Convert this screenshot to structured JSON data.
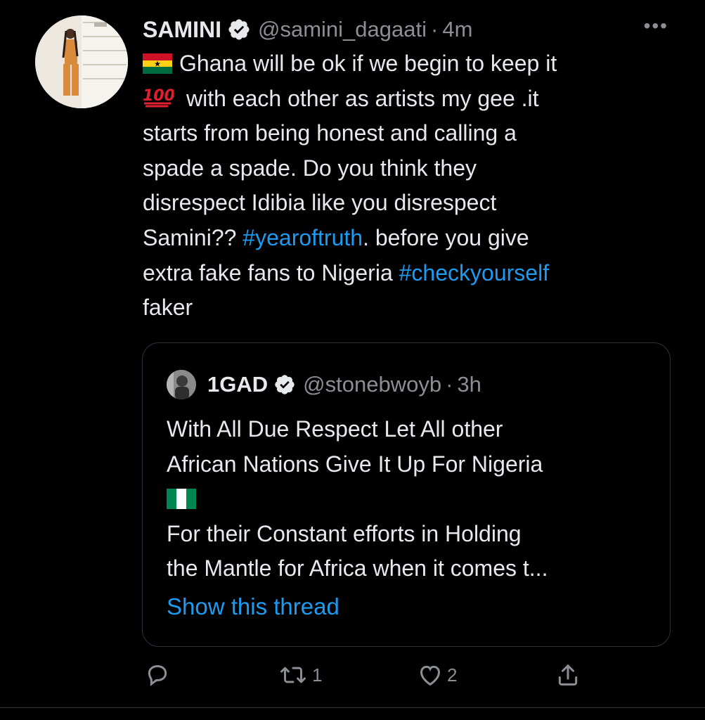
{
  "tweet": {
    "author_name": "SAMINI",
    "handle": "@samini_dagaati",
    "separator": "·",
    "time": "4m",
    "more_label": "•••",
    "lines": {
      "l1": "Ghana will be ok if we begin to keep it",
      "l2": "with each other as artists my gee .it",
      "l3": "starts from being honest and calling a",
      "l4": "spade a spade. Do you think they",
      "l5": "disrespect Idibia like you disrespect",
      "l6a": "Samini?? ",
      "l6tag": "#yearoftruth",
      "l6b": ". before you give",
      "l7a": "extra fake fans to Nigeria ",
      "l7tag": "#checkyourself",
      "l8": "faker"
    },
    "emoji": {
      "flag": "ghana-flag",
      "hundred": "hundred-points"
    }
  },
  "quoted_tweet": {
    "author_name": "1GAD",
    "handle": "@stonebwoyb",
    "separator": "·",
    "time": "3h",
    "lines": {
      "l1": "With All Due Respect Let All other",
      "l2": "African Nations  Give It Up For Nigeria",
      "l4": "For their Constant efforts in Holding",
      "l5": "the Mantle for Africa when it comes t..."
    },
    "emoji": {
      "flag": "nigeria-flag"
    },
    "show_thread": "Show this thread"
  },
  "actions": {
    "reply": {
      "icon": "reply-icon",
      "count": ""
    },
    "retweet": {
      "icon": "retweet-icon",
      "count": "1"
    },
    "like": {
      "icon": "heart-icon",
      "count": "2"
    },
    "share": {
      "icon": "share-icon",
      "count": ""
    }
  },
  "colors": {
    "background": "#000000",
    "text": "#e7e9ea",
    "secondary": "#8b8f94",
    "link": "#1d9bf0",
    "border": "#2f3336"
  }
}
